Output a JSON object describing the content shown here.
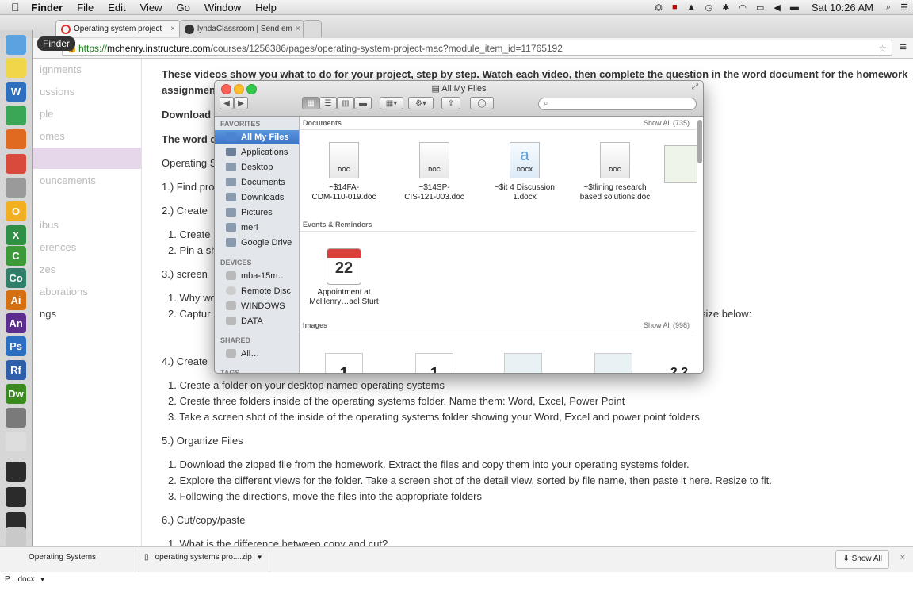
{
  "menubar": {
    "apple": "",
    "items": [
      "Finder",
      "File",
      "Edit",
      "View",
      "Go",
      "Window",
      "Help"
    ],
    "clock": "Sat 10:26 AM"
  },
  "tabs": [
    {
      "label": "Operating system project",
      "close": "×"
    },
    {
      "label": "lyndaClassroom | Send em",
      "close": "×"
    }
  ],
  "address": {
    "scheme": "https://",
    "host": "mchenry.instructure.com",
    "path": "/courses/1256386/pages/operating-system-project-mac?module_item_id=11765192"
  },
  "dock_tooltip": "Finder",
  "dock_icons": [
    {
      "name": "finder-icon",
      "text": "",
      "color": "#5ba3e0"
    },
    {
      "name": "clock-app-icon",
      "text": "",
      "color": "#f2d64a"
    },
    {
      "name": "word-icon",
      "text": "W",
      "color": "#2e6fbf"
    },
    {
      "name": "google-drive-icon",
      "text": "",
      "color": "#3aa757"
    },
    {
      "name": "firefox-icon",
      "text": "",
      "color": "#e06a1f"
    },
    {
      "name": "chrome-icon",
      "text": "",
      "color": "#d94a3d"
    },
    {
      "name": "calculator-icon",
      "text": "",
      "color": "#9a9a9a"
    },
    {
      "name": "openoffice-icon",
      "text": "O",
      "color": "#f0b020"
    },
    {
      "name": "excel-icon",
      "text": "X",
      "color": "#2f8f44"
    },
    {
      "name": "camtasia-icon",
      "text": "C",
      "color": "#3d9a3a"
    },
    {
      "name": "captivate-icon",
      "text": "Co",
      "color": "#2f7f6a"
    },
    {
      "name": "illustrator-icon",
      "text": "Ai",
      "color": "#d46f12"
    },
    {
      "name": "animate-icon",
      "text": "An",
      "color": "#5c2d8f"
    },
    {
      "name": "photoshop-icon",
      "text": "Ps",
      "color": "#2a6fc1"
    },
    {
      "name": "flash-builder-icon",
      "text": "Rf",
      "color": "#2f5fa8"
    },
    {
      "name": "dreamweaver-icon",
      "text": "Dw",
      "color": "#3b8a1f"
    },
    {
      "name": "screen-capture-icon",
      "text": "",
      "color": "#7a7a7a"
    },
    {
      "name": "textedit-icon",
      "text": "",
      "color": "#dddddd"
    },
    {
      "name": "terminal-window-icon",
      "text": "",
      "color": "#2b2b2b"
    },
    {
      "name": "terminal-window-icon",
      "text": "",
      "color": "#2b2b2b"
    },
    {
      "name": "terminal-window-icon",
      "text": "",
      "color": "#2b2b2b"
    },
    {
      "name": "trash-icon",
      "text": "",
      "color": "#c9c9c9"
    }
  ],
  "leftnav": [
    "ignments",
    "ussions",
    "ple",
    "omes",
    "",
    "ouncements",
    "",
    "ibus",
    "erences",
    "zes",
    "aborations",
    "ngs"
  ],
  "content": {
    "intro": "These videos show you what to do for your project, step by step. Watch each video, then complete the question in the word document for the homework",
    "intro2": "assignmen",
    "download": "Download",
    "word_doc": "The word d",
    "os_s": "Operating S",
    "i1": "1.)  Find pro",
    "i2": "2.)  Create",
    "i2a": "1.  Create",
    "i2b": "2.  Pin a sh",
    "i3": "3.)  screen",
    "i3a": "1.  Why wo",
    "i3b": "2.  Captur",
    "size_below": "size below:",
    "i4": "4.)  Create",
    "i4a": "1.  Create a folder on your desktop named operating systems",
    "i4b": "2.  Create three folders inside of the operating systems folder. Name them: Word, Excel, Power Point",
    "i4c": "3.  Take a screen shot of the inside of the operating systems folder showing your Word, Excel and power point folders.",
    "i5": "5.)  Organize Files",
    "i5a": "1.  Download the zipped file from the homework. Extract the files and copy them into your operating systems folder.",
    "i5b": "2.  Explore the different views for the folder. Take a screen shot of the detail view, sorted by file name, then paste it here. Resize to fit.",
    "i5c": "3.  Following the directions, move the files into the appropriate folders",
    "i6": "6.)  Cut/copy/paste",
    "i6a": "1.  What is the difference between copy and cut?"
  },
  "finder": {
    "title": "All My Files",
    "search_placeholder": "",
    "sidebar": {
      "favorites_header": "FAVORITES",
      "favorites": [
        "All My Files",
        "Applications",
        "Desktop",
        "Documents",
        "Downloads",
        "Pictures",
        "meri",
        "Google Drive"
      ],
      "devices_header": "DEVICES",
      "devices": [
        "mba-15m…",
        "Remote Disc",
        "WINDOWS",
        "DATA"
      ],
      "shared_header": "SHARED",
      "shared": [
        "All…"
      ],
      "tags_header": "TAGS"
    },
    "sections": {
      "documents": {
        "title": "Documents",
        "show_all": "Show All (735)"
      },
      "events": {
        "title": "Events & Reminders"
      },
      "images": {
        "title": "Images",
        "show_all": "Show All (998)"
      }
    },
    "files": [
      {
        "label": "~$14FA-\nCDM-110-019.doc",
        "type": "DOC"
      },
      {
        "label": "~$14SP-\nCIS-121-003.doc",
        "type": "DOC"
      },
      {
        "label": "~$it 4 Discussion\n1.docx",
        "type": "DOCX"
      },
      {
        "label": "~$tlining research\nbased solutions.doc",
        "type": "DOC"
      }
    ],
    "event": {
      "label": "Appointment at\nMcHenry…ael Sturt",
      "month": "",
      "day": "22"
    },
    "image_thumbs": [
      "1",
      "1",
      "",
      "",
      "2 2"
    ]
  },
  "downloads": [
    {
      "label": "Operating Systems P....docx"
    },
    {
      "label": "operating systems pro....zip"
    }
  ],
  "show_all_downloads": "Show All",
  "close_downloads": "×"
}
